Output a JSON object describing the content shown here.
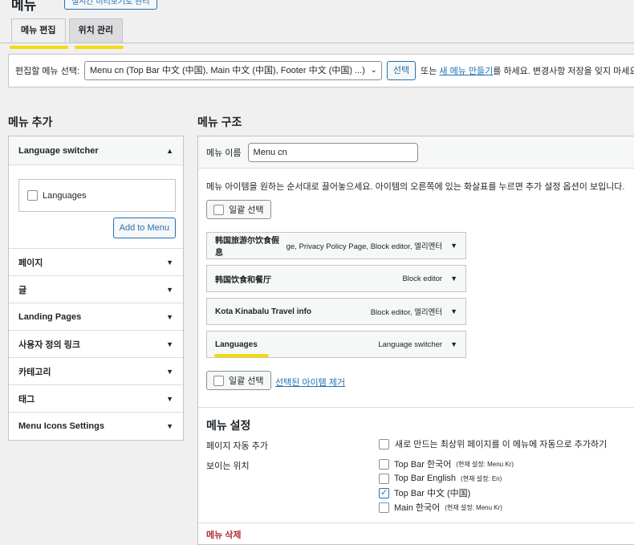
{
  "header": {
    "title": "메뉴",
    "manage_button": "실시간 미리보기로 관리"
  },
  "tabs": [
    {
      "label": "메뉴 편집"
    },
    {
      "label": "위치 관리"
    }
  ],
  "selector": {
    "label": "편집할 메뉴 선택:",
    "selected": "Menu cn (Top Bar 中文 (中国), Main 中文 (中国), Footer 中文 (中国) ...)",
    "select_button": "선택",
    "text_or": "또는",
    "create_link": "새 메뉴 만들기",
    "text_after": "를 하세요. 변경사항 저장을 잊지 마세요!"
  },
  "left": {
    "heading": "메뉴 추가",
    "open_section": {
      "title": "Language switcher",
      "checkbox_label": "Languages",
      "add_button": "Add to Menu"
    },
    "sections": [
      {
        "label": "페이지"
      },
      {
        "label": "글"
      },
      {
        "label": "Landing Pages"
      },
      {
        "label": "사용자 정의 링크"
      },
      {
        "label": "카테고리"
      },
      {
        "label": "태그"
      },
      {
        "label": "Menu Icons Settings"
      }
    ]
  },
  "right": {
    "heading": "메뉴 구조",
    "menu_name_label": "메뉴 이름",
    "menu_name_value": "Menu cn",
    "instructions": "메뉴 아이템을 원하는 순서대로 끌어놓으세요. 아이템의 오른쪽에 있는 화살표를 누르면 추가 설정 옵션이 보입니다.",
    "bulk_select": "일괄 선택",
    "remove_selected": "선택된 아이템 제거",
    "items": [
      {
        "title": "韩国旅游尔饮食假息",
        "meta": "ge, Privacy Policy Page, Block editor, 엘리멘터"
      },
      {
        "title": "韩国饮食和餐厅",
        "meta": "Block editor"
      },
      {
        "title": "Kota Kinabalu Travel info",
        "meta": "Block editor, 엘리멘터"
      },
      {
        "title": "Languages",
        "meta": "Language switcher"
      }
    ],
    "settings": {
      "heading": "메뉴 설정",
      "auto_add_label": "페이지 자동 추가",
      "auto_add_option": "새로 만드는 최상위 페이지를 이 메뉴에 자동으로 추가하기",
      "location_label": "보이는 위치",
      "locations": [
        {
          "name": "Top Bar 한국어",
          "note": "(현재 설정: Menu Kr)",
          "checked": false
        },
        {
          "name": "Top Bar English",
          "note": "(현재 설정: En)",
          "checked": false
        },
        {
          "name": "Top Bar 中文 (中国)",
          "note": "",
          "checked": true
        },
        {
          "name": "Main 한국어",
          "note": "(현재 설정: Menu Kr)",
          "checked": false
        }
      ],
      "cut_heading": "메뉴 삭제"
    }
  },
  "colors": {
    "accent": "#2271b1",
    "highlight": "#f5dc0a",
    "background": "#f0f0f1"
  }
}
